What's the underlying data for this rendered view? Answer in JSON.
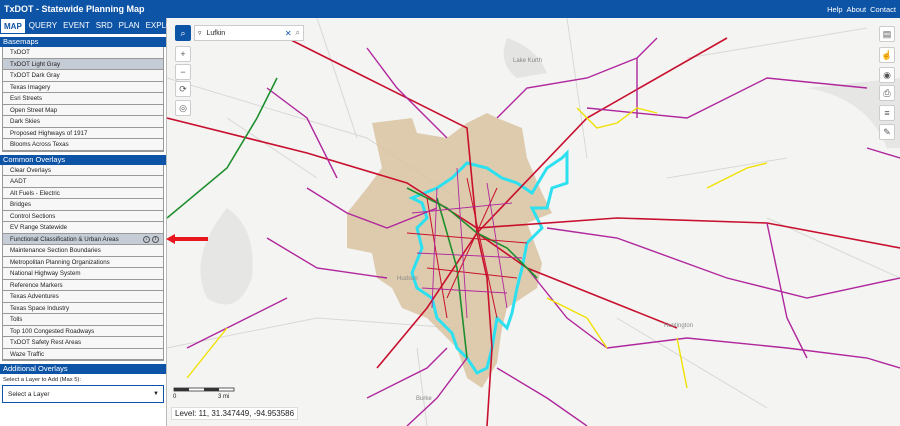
{
  "app": {
    "title": "TxDOT - Statewide Planning Map",
    "links": [
      "Help",
      "About",
      "Contact"
    ]
  },
  "sidebar": {
    "tabs": [
      "MAP",
      "QUERY",
      "EVENT",
      "SRD",
      "PLAN",
      "EXPLORE"
    ],
    "active_tab": "MAP",
    "basemaps": {
      "header": "Basemaps",
      "items": [
        "TxDOT",
        "TxDOT Light Gray",
        "TxDOT Dark Gray",
        "Texas Imagery",
        "Esri Streets",
        "Open Street Map",
        "Dark Skies",
        "Proposed Highways of 1917",
        "Blooms Across Texas"
      ],
      "selected": "TxDOT Light Gray"
    },
    "common_overlays": {
      "header": "Common Overlays",
      "items": [
        "Clear Overlays",
        "AADT",
        "Alt Fuels - Electric",
        "Bridges",
        "Control Sections",
        "EV Range Statewide",
        "Functional Classification & Urban Areas",
        "Maintenance Section Boundaries",
        "Metropolitan Planning Organizations",
        "National Highway System",
        "Reference Markers",
        "Texas Adventures",
        "Texas Space Industry",
        "Tolls",
        "Top 100 Congested Roadways",
        "TxDOT Safety Rest Areas",
        "Waze Traffic"
      ],
      "selected": "Functional Classification & Urban Areas"
    },
    "additional_overlays": {
      "header": "Additional Overlays",
      "label": "Select a Layer to Add (Max 5):",
      "select_value": "Select a Layer"
    }
  },
  "map": {
    "search_value": "Lufkin",
    "status": "Level: 11, 31.347449, -94.953586",
    "scale_labels": [
      "0",
      "3 mi"
    ],
    "place_labels": [
      "Lake Kurth",
      "Hudson",
      "Huntington",
      "Burke"
    ],
    "colors": {
      "header_blue": "#0e54a6",
      "principal_arterial": "#c8102e",
      "minor_arterial": "#b0279c",
      "collector": "#f0e000",
      "freeway": "#1f8f2e",
      "urban_boundary": "#2de0f0",
      "urban_area_fill": "#d9c3a0"
    },
    "icons": [
      "search-icon",
      "zoom-in-icon",
      "zoom-out-icon",
      "refresh-icon",
      "locate-icon",
      "layers-icon",
      "tap-icon",
      "identify-icon",
      "print-icon",
      "list-icon",
      "edit-icon"
    ]
  }
}
